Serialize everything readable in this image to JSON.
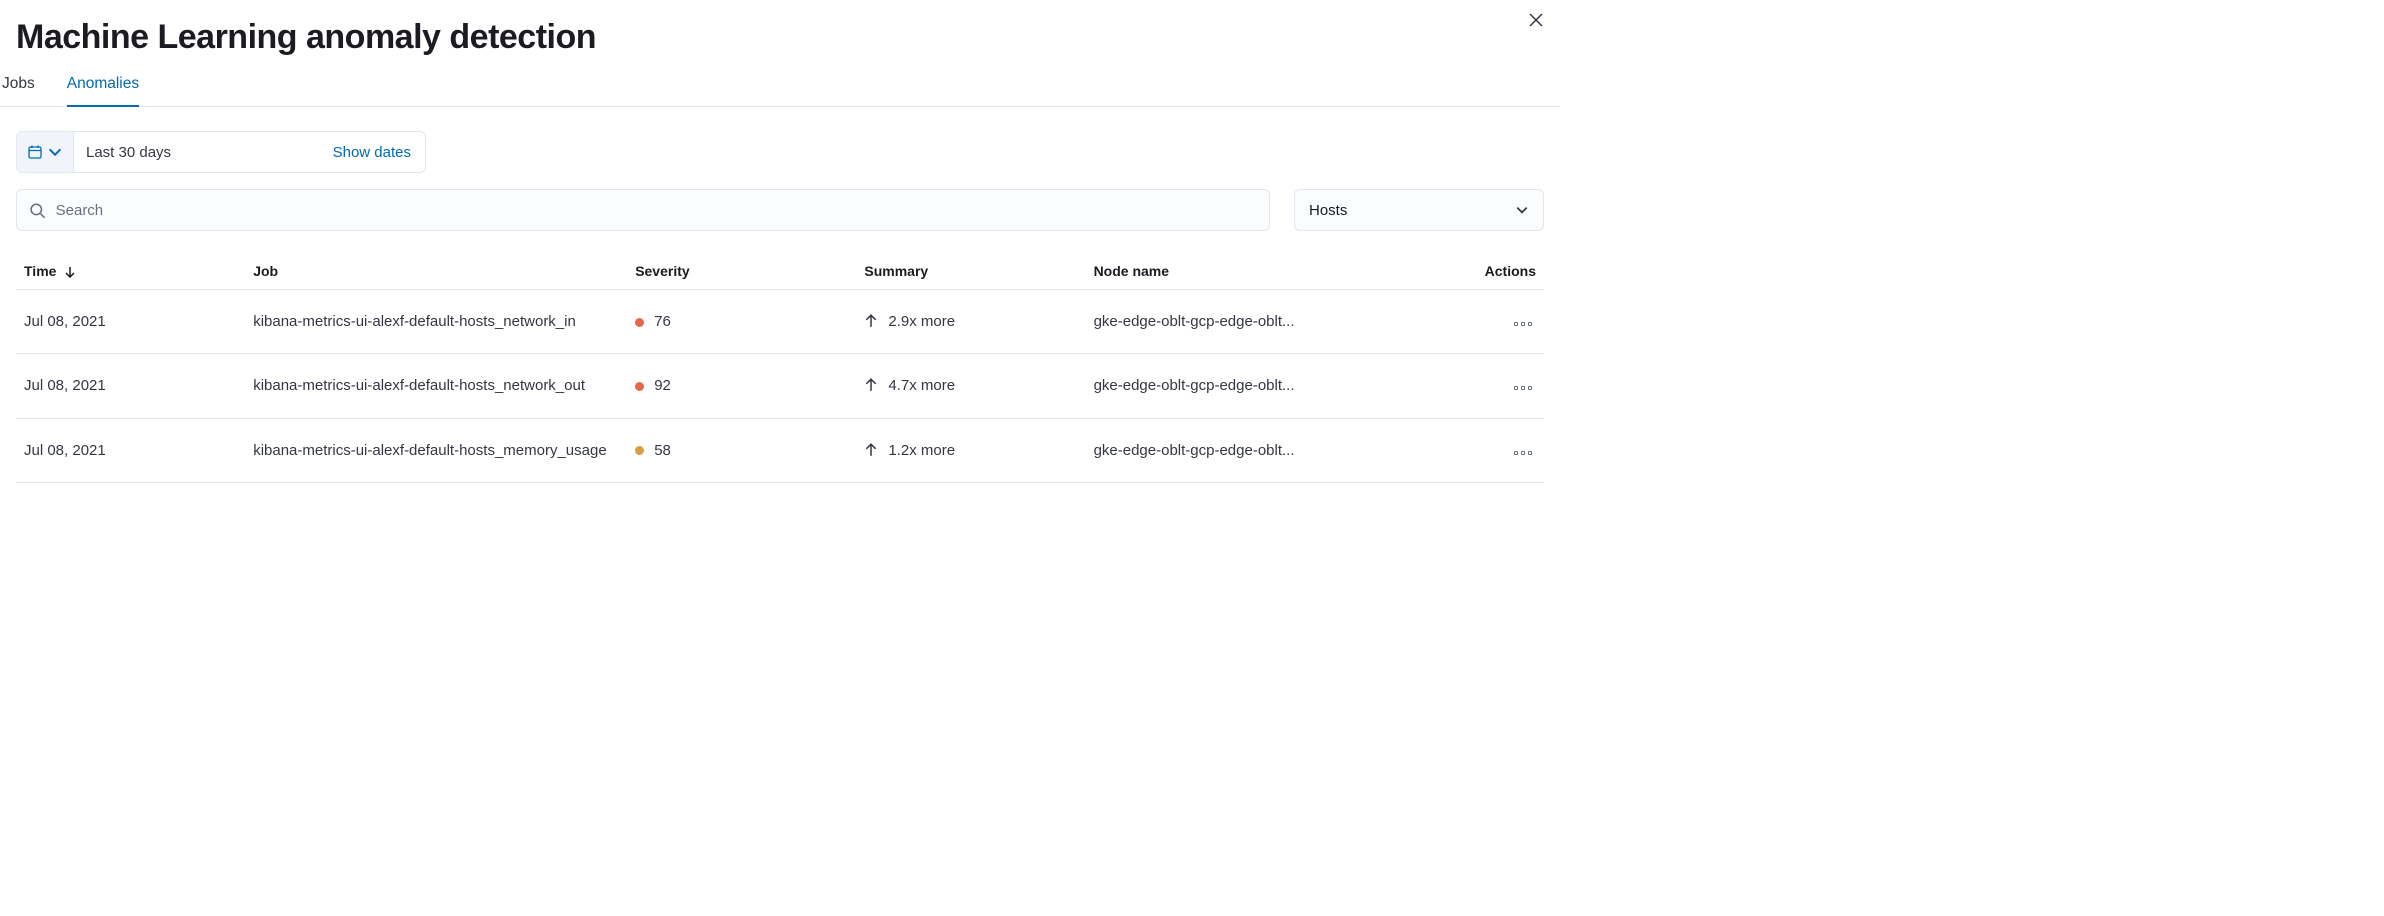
{
  "header": {
    "title": "Machine Learning anomaly detection"
  },
  "tabs": [
    {
      "label": "Jobs",
      "active": false
    },
    {
      "label": "Anomalies",
      "active": true
    }
  ],
  "datePicker": {
    "range_label": "Last 30 days",
    "show_dates_label": "Show dates"
  },
  "search": {
    "placeholder": "Search",
    "value": ""
  },
  "scopeDropdown": {
    "selected": "Hosts"
  },
  "table": {
    "columns": {
      "time": "Time",
      "job": "Job",
      "severity": "Severity",
      "summary": "Summary",
      "node": "Node name",
      "actions": "Actions"
    },
    "rows": [
      {
        "time": "Jul 08, 2021",
        "job": "kibana-metrics-ui-alexf-default-hosts_network_in",
        "severity": "76",
        "severity_color": "#e7664c",
        "summary_direction": "up",
        "summary": "2.9x more",
        "node": "gke-edge-oblt-gcp-edge-oblt..."
      },
      {
        "time": "Jul 08, 2021",
        "job": "kibana-metrics-ui-alexf-default-hosts_network_out",
        "severity": "92",
        "severity_color": "#e7664c",
        "summary_direction": "up",
        "summary": "4.7x more",
        "node": "gke-edge-oblt-gcp-edge-oblt..."
      },
      {
        "time": "Jul 08, 2021",
        "job": "kibana-metrics-ui-alexf-default-hosts_memory_usage",
        "severity": "58",
        "severity_color": "#d6a042",
        "summary_direction": "up",
        "summary": "1.2x more",
        "node": "gke-edge-oblt-gcp-edge-oblt..."
      }
    ]
  }
}
